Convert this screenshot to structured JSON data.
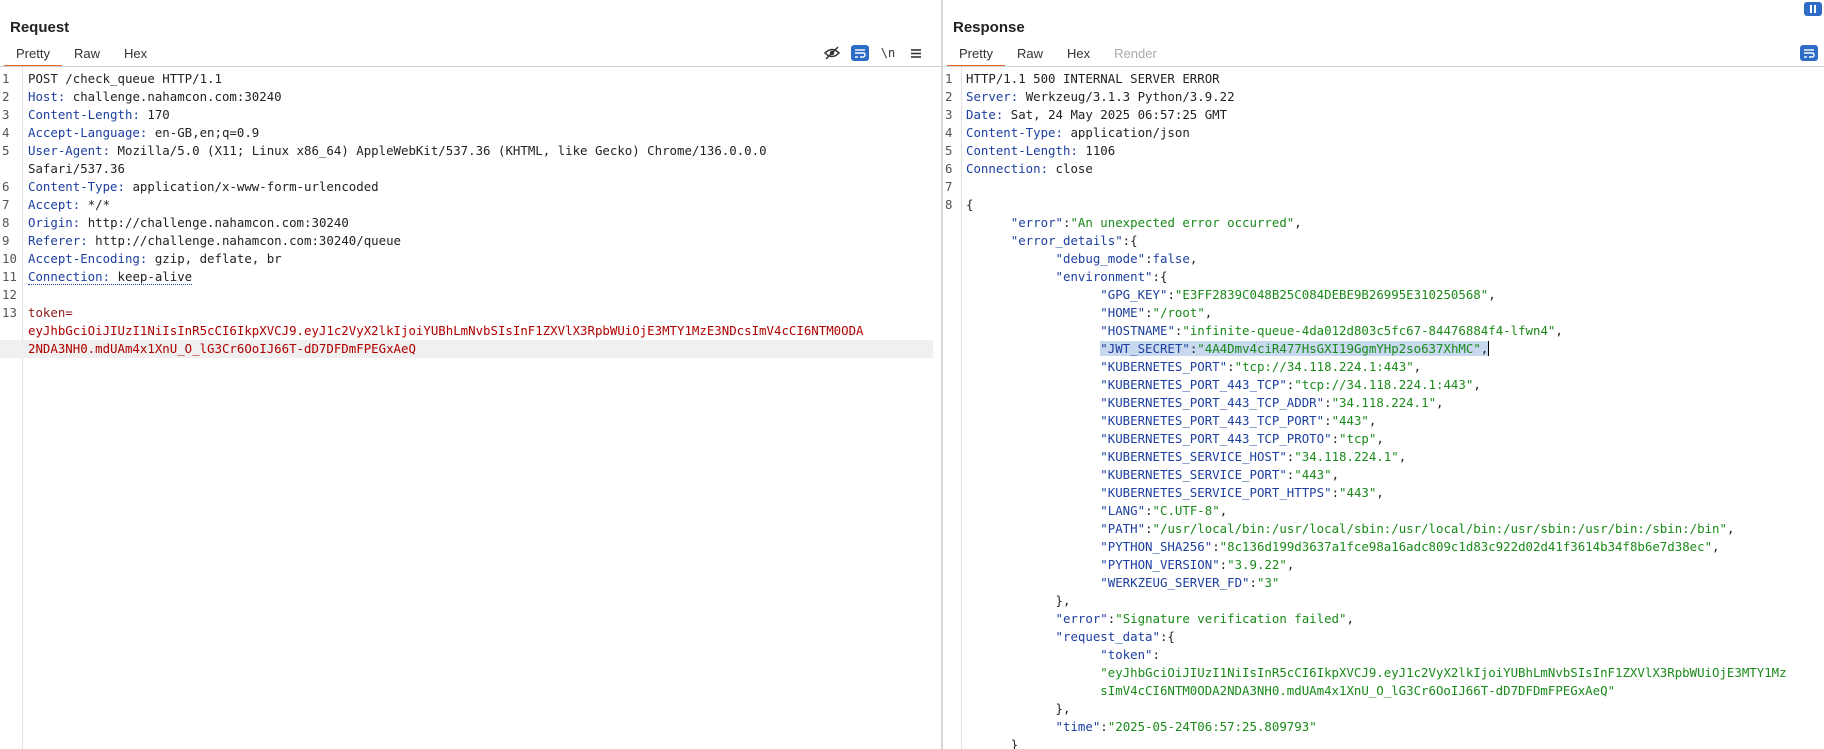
{
  "request": {
    "title": "Request",
    "tabs": [
      "Pretty",
      "Raw",
      "Hex"
    ],
    "toolbar": {
      "newline_label": "\\n"
    },
    "request_line": "POST /check_queue HTTP/1.1",
    "headers": [
      {
        "name": "Host",
        "value": "challenge.nahamcon.com:30240"
      },
      {
        "name": "Content-Length",
        "value": "170"
      },
      {
        "name": "Accept-Language",
        "value": "en-GB,en;q=0.9"
      },
      {
        "name": "User-Agent",
        "value": "Mozilla/5.0 (X11; Linux x86_64) AppleWebKit/537.36 (KHTML, like Gecko) Chrome/136.0.0.0"
      },
      {
        "name": "Content-Type",
        "value": "application/x-www-form-urlencoded"
      },
      {
        "name": "Accept",
        "value": "*/*"
      },
      {
        "name": "Origin",
        "value": "http://challenge.nahamcon.com:30240"
      },
      {
        "name": "Referer",
        "value": "http://challenge.nahamcon.com:30240/queue"
      },
      {
        "name": "Accept-Encoding",
        "value": "gzip, deflate, br"
      },
      {
        "name": "Connection",
        "value": "keep-alive"
      }
    ],
    "user_agent_wrap": "Safari/537.36",
    "body_key": "token=",
    "body_value_1": "eyJhbGciOiJIUzI1NiIsInR5cCI6IkpXVCJ9.eyJ1c2VyX2lkIjoiYUBhLmNvbSIsInF1ZXVlX3RpbWUiOjE3MTY1MzE3NDcsImV4cCI6NTM0ODA",
    "body_value_2": "2NDA3NH0.mdUAm4x1XnU_O_lG3Cr6OoIJ66T-dD7DFDmFPEGxAeQ",
    "line_numbers": [
      "1",
      "2",
      "3",
      "4",
      "5",
      "",
      "6",
      "7",
      "8",
      "9",
      "10",
      "11",
      "12",
      "13",
      "",
      ""
    ]
  },
  "response": {
    "title": "Response",
    "tabs": [
      "Pretty",
      "Raw",
      "Hex",
      "Render"
    ],
    "status_line": "HTTP/1.1 500 INTERNAL SERVER ERROR",
    "headers": [
      {
        "name": "Server",
        "value": "Werkzeug/3.1.3 Python/3.9.22"
      },
      {
        "name": "Date",
        "value": "Sat, 24 May 2025 06:57:25 GMT"
      },
      {
        "name": "Content-Type",
        "value": "application/json"
      },
      {
        "name": "Content-Length",
        "value": "1106"
      },
      {
        "name": "Connection",
        "value": "close"
      }
    ],
    "line_numbers": [
      "1",
      "2",
      "3",
      "4",
      "5",
      "6",
      "7",
      "8"
    ],
    "json": {
      "error": "An unexpected error occurred",
      "debug_mode": "false",
      "environment": [
        {
          "key": "GPG_KEY",
          "value": "E3FF2839C048B25C084DEBE9B26995E310250568"
        },
        {
          "key": "HOME",
          "value": "/root"
        },
        {
          "key": "HOSTNAME",
          "value": "infinite-queue-4da012d803c5fc67-84476884f4-lfwn4"
        },
        {
          "key": "JWT_SECRET",
          "value": "4A4Dmv4ciR477HsGXI19GgmYHp2so637XhMC"
        },
        {
          "key": "KUBERNETES_PORT",
          "value": "tcp://34.118.224.1:443"
        },
        {
          "key": "KUBERNETES_PORT_443_TCP",
          "value": "tcp://34.118.224.1:443"
        },
        {
          "key": "KUBERNETES_PORT_443_TCP_ADDR",
          "value": "34.118.224.1"
        },
        {
          "key": "KUBERNETES_PORT_443_TCP_PORT",
          "value": "443"
        },
        {
          "key": "KUBERNETES_PORT_443_TCP_PROTO",
          "value": "tcp"
        },
        {
          "key": "KUBERNETES_SERVICE_HOST",
          "value": "34.118.224.1"
        },
        {
          "key": "KUBERNETES_SERVICE_PORT",
          "value": "443"
        },
        {
          "key": "KUBERNETES_SERVICE_PORT_HTTPS",
          "value": "443"
        },
        {
          "key": "LANG",
          "value": "C.UTF-8"
        },
        {
          "key": "PATH",
          "value": "/usr/local/bin:/usr/local/sbin:/usr/local/bin:/usr/sbin:/usr/bin:/sbin:/bin"
        },
        {
          "key": "PYTHON_SHA256",
          "value": "8c136d199d3637a1fce98a16adc809c1d83c922d02d41f3614b34f8b6e7d38ec"
        },
        {
          "key": "PYTHON_VERSION",
          "value": "3.9.22"
        },
        {
          "key": "WERKZEUG_SERVER_FD",
          "value": "3"
        }
      ],
      "inner_error": "Signature verification failed",
      "token_value_1": "eyJhbGciOiJIUzI1NiIsInR5cCI6IkpXVCJ9.eyJ1c2VyX2lkIjoiYUBhLmNvbSIsInF1ZXVlX3RpbWUiOjE3MTY1Mz",
      "token_value_2": "sImV4cCI6NTM0ODA2NDA3NH0.mdUAm4x1XnU_O_lG3Cr6OoIJ66T-dD7DFDmFPEGxAeQ",
      "time": "2025-05-24T06:57:25.809793"
    }
  },
  "colors": {
    "accent": "#e8692c",
    "toggle_blue": "#2d6dc5",
    "key_blue": "#1c3fa0",
    "string_green": "#1a8a1a",
    "body_red": "#b00000"
  }
}
